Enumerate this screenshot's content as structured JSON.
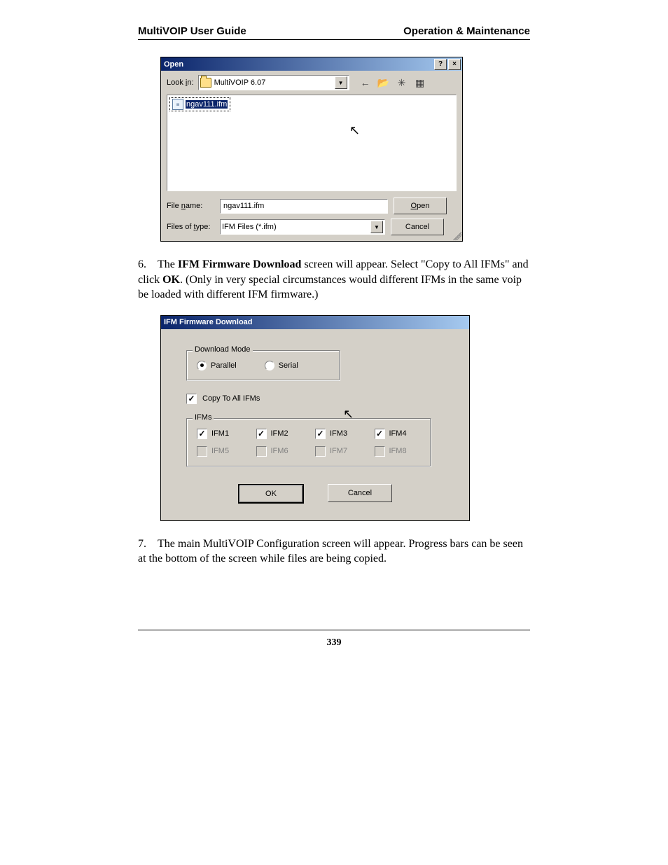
{
  "header": {
    "left": "MultiVOIP User Guide",
    "right": "Operation & Maintenance"
  },
  "open_dialog": {
    "title": "Open",
    "lookin_label": "Look in:",
    "lookin_value": "MultiVOIP 6.07",
    "nav": {
      "back": "←",
      "up": "📂",
      "newfolder": "✳",
      "views": "▦"
    },
    "selected_file": "ngav111.ifm",
    "filename_label": "File name:",
    "filename_value": "ngav111.ifm",
    "type_label": "Files of type:",
    "type_value": "IFM Files (*.ifm)",
    "open_btn": "Open",
    "cancel_btn": "Cancel"
  },
  "para6": {
    "num": "6.",
    "pre": "The ",
    "bold": "IFM Firmware Download",
    "mid": " screen will appear.  Select \"Copy to All IFMs\" and click ",
    "bold2": "OK",
    "post": ".  (Only in very special circumstances would different IFMs in the same voip be loaded with different IFM firmware.)"
  },
  "ifm_dialog": {
    "title": "IFM Firmware Download",
    "mode_label": "Download Mode",
    "parallel": "Parallel",
    "serial": "Serial",
    "copy_label": "Copy To All IFMs",
    "ifms_label": "IFMs",
    "ifms": [
      "IFM1",
      "IFM2",
      "IFM3",
      "IFM4",
      "IFM5",
      "IFM6",
      "IFM7",
      "IFM8"
    ],
    "ok": "OK",
    "cancel": "Cancel"
  },
  "para7": {
    "num": "7.",
    "text": "The main MultiVOIP Configuration screen will appear.  Progress bars can be seen at the bottom of the screen while files are being copied."
  },
  "footer": "339"
}
